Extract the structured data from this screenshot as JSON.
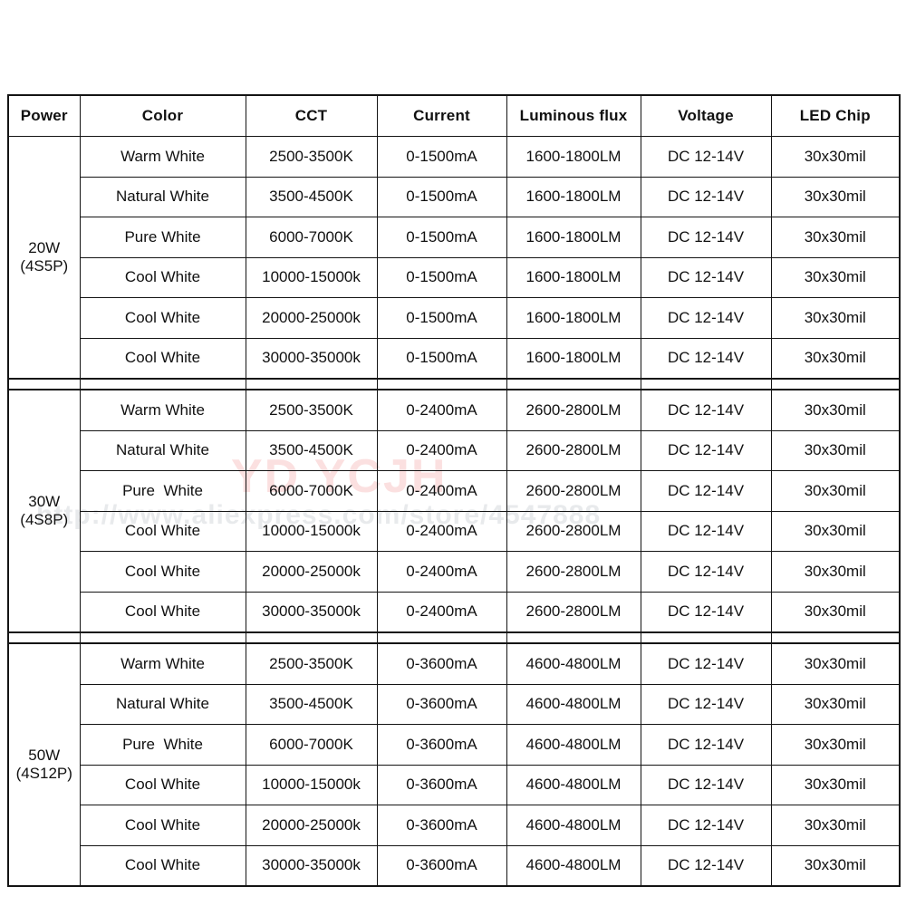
{
  "document": {
    "title": "LED Chip Specification Table"
  },
  "watermark": {
    "brand": "YD YCJH",
    "url": "http://www.aliexpress.com/store/4547888"
  },
  "table": {
    "columns": [
      {
        "key": "power",
        "label": "Power"
      },
      {
        "key": "color",
        "label": "Color"
      },
      {
        "key": "cct",
        "label": "CCT"
      },
      {
        "key": "current",
        "label": "Current"
      },
      {
        "key": "flux",
        "label": "Luminous flux"
      },
      {
        "key": "voltage",
        "label": "Voltage"
      },
      {
        "key": "chip",
        "label": "LED Chip"
      }
    ],
    "groups": [
      {
        "power_watt": "20W",
        "power_config": "(4S5P)",
        "rows": [
          {
            "color": "Warm White",
            "cct": "2500-3500K",
            "current": "0-1500mA",
            "flux": "1600-1800LM",
            "voltage": "DC 12-14V",
            "chip": "30x30mil"
          },
          {
            "color": "Natural White",
            "cct": "3500-4500K",
            "current": "0-1500mA",
            "flux": "1600-1800LM",
            "voltage": "DC 12-14V",
            "chip": "30x30mil"
          },
          {
            "color": "Pure White",
            "cct": "6000-7000K",
            "current": "0-1500mA",
            "flux": "1600-1800LM",
            "voltage": "DC 12-14V",
            "chip": "30x30mil"
          },
          {
            "color": "Cool White",
            "cct": "10000-15000k",
            "current": "0-1500mA",
            "flux": "1600-1800LM",
            "voltage": "DC 12-14V",
            "chip": "30x30mil"
          },
          {
            "color": "Cool White",
            "cct": "20000-25000k",
            "current": "0-1500mA",
            "flux": "1600-1800LM",
            "voltage": "DC 12-14V",
            "chip": "30x30mil"
          },
          {
            "color": "Cool White",
            "cct": "30000-35000k",
            "current": "0-1500mA",
            "flux": "1600-1800LM",
            "voltage": "DC 12-14V",
            "chip": "30x30mil"
          }
        ]
      },
      {
        "power_watt": "30W",
        "power_config": "(4S8P)",
        "rows": [
          {
            "color": "Warm White",
            "cct": "2500-3500K",
            "current": "0-2400mA",
            "flux": "2600-2800LM",
            "voltage": "DC 12-14V",
            "chip": "30x30mil"
          },
          {
            "color": "Natural White",
            "cct": "3500-4500K",
            "current": "0-2400mA",
            "flux": "2600-2800LM",
            "voltage": "DC 12-14V",
            "chip": "30x30mil"
          },
          {
            "color": "Pure  White",
            "cct": "6000-7000K",
            "current": "0-2400mA",
            "flux": "2600-2800LM",
            "voltage": "DC 12-14V",
            "chip": "30x30mil"
          },
          {
            "color": "Cool White",
            "cct": "10000-15000k",
            "current": "0-2400mA",
            "flux": "2600-2800LM",
            "voltage": "DC 12-14V",
            "chip": "30x30mil"
          },
          {
            "color": "Cool White",
            "cct": "20000-25000k",
            "current": "0-2400mA",
            "flux": "2600-2800LM",
            "voltage": "DC 12-14V",
            "chip": "30x30mil"
          },
          {
            "color": "Cool White",
            "cct": "30000-35000k",
            "current": "0-2400mA",
            "flux": "2600-2800LM",
            "voltage": "DC 12-14V",
            "chip": "30x30mil"
          }
        ]
      },
      {
        "power_watt": "50W",
        "power_config": "(4S12P)",
        "rows": [
          {
            "color": "Warm White",
            "cct": "2500-3500K",
            "current": "0-3600mA",
            "flux": "4600-4800LM",
            "voltage": "DC 12-14V",
            "chip": "30x30mil"
          },
          {
            "color": "Natural White",
            "cct": "3500-4500K",
            "current": "0-3600mA",
            "flux": "4600-4800LM",
            "voltage": "DC 12-14V",
            "chip": "30x30mil"
          },
          {
            "color": "Pure  White",
            "cct": "6000-7000K",
            "current": "0-3600mA",
            "flux": "4600-4800LM",
            "voltage": "DC 12-14V",
            "chip": "30x30mil"
          },
          {
            "color": "Cool White",
            "cct": "10000-15000k",
            "current": "0-3600mA",
            "flux": "4600-4800LM",
            "voltage": "DC 12-14V",
            "chip": "30x30mil"
          },
          {
            "color": "Cool White",
            "cct": "20000-25000k",
            "current": "0-3600mA",
            "flux": "4600-4800LM",
            "voltage": "DC 12-14V",
            "chip": "30x30mil"
          },
          {
            "color": "Cool White",
            "cct": "30000-35000k",
            "current": "0-3600mA",
            "flux": "4600-4800LM",
            "voltage": "DC 12-14V",
            "chip": "30x30mil"
          }
        ]
      }
    ]
  }
}
